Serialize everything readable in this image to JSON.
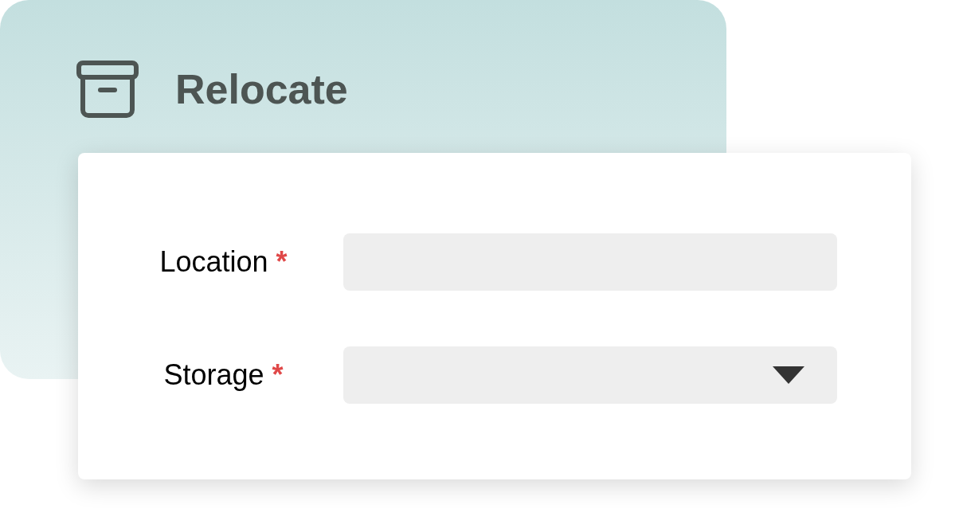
{
  "header": {
    "title": "Relocate"
  },
  "fields": [
    {
      "kind": "text",
      "label": "Location",
      "required_mark": "*"
    },
    {
      "kind": "select",
      "label": "Storage",
      "required_mark": "*"
    }
  ]
}
